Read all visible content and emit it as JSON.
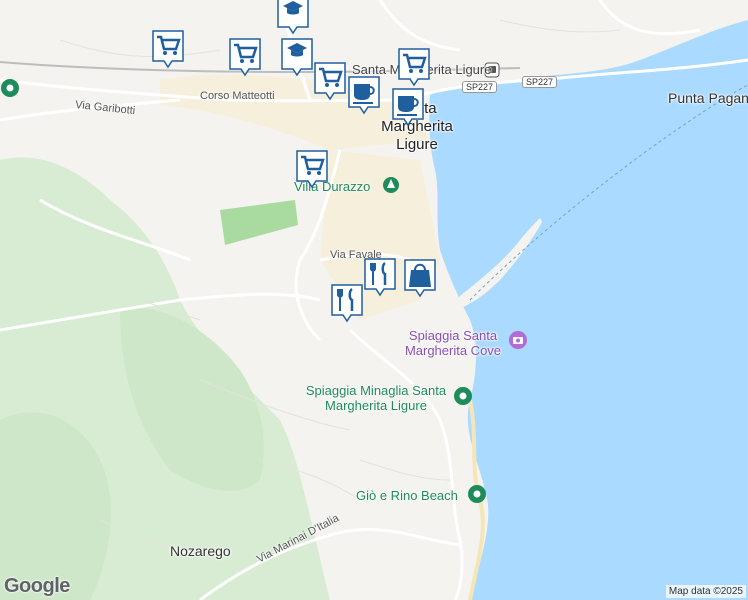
{
  "places": {
    "santa_margherita": "Santa Margherita Ligure",
    "santa_margherita_line1": "Santa",
    "santa_margherita_line2": "Margherita",
    "santa_margherita_line3": "Ligure",
    "punta_pagana": "Punta Pagana",
    "nozarego": "Nozarego",
    "villa_durazzo": "Villa Durazzo"
  },
  "roads": {
    "via_garibotti": "Via Garibotti",
    "corso_matteotti": "Corso Matteotti",
    "via_favale": "Via Favale",
    "via_marinai": "Via Marinai D'Italia",
    "sp227_a": "SP227",
    "sp227_b": "SP227"
  },
  "pois": {
    "spiaggia_santa_margherita_cove_1": "Spiaggia Santa",
    "spiaggia_santa_margherita_cove_2": "Margherita Cove",
    "spiaggia_minaglia_1": "Spiaggia Minaglia Santa",
    "spiaggia_minaglia_2": "Margherita Ligure",
    "gio_rino_beach": "Giò e Rino Beach"
  },
  "markers": [
    {
      "type": "education"
    },
    {
      "type": "education"
    },
    {
      "type": "shopping-cart"
    },
    {
      "type": "shopping-cart"
    },
    {
      "type": "shopping-cart"
    },
    {
      "type": "shopping-cart"
    },
    {
      "type": "shopping-cart"
    },
    {
      "type": "cafe"
    },
    {
      "type": "cafe"
    },
    {
      "type": "restaurant"
    },
    {
      "type": "restaurant"
    },
    {
      "type": "shopping-bag"
    }
  ],
  "colors": {
    "water": "#a8d8ea",
    "land": "#f2f2f0",
    "park": "#c8e6c9",
    "marker_fill": "#1f5f9e",
    "marker_bg": "#ffffff"
  },
  "attribution": "Map data ©2025",
  "logo": "Google"
}
